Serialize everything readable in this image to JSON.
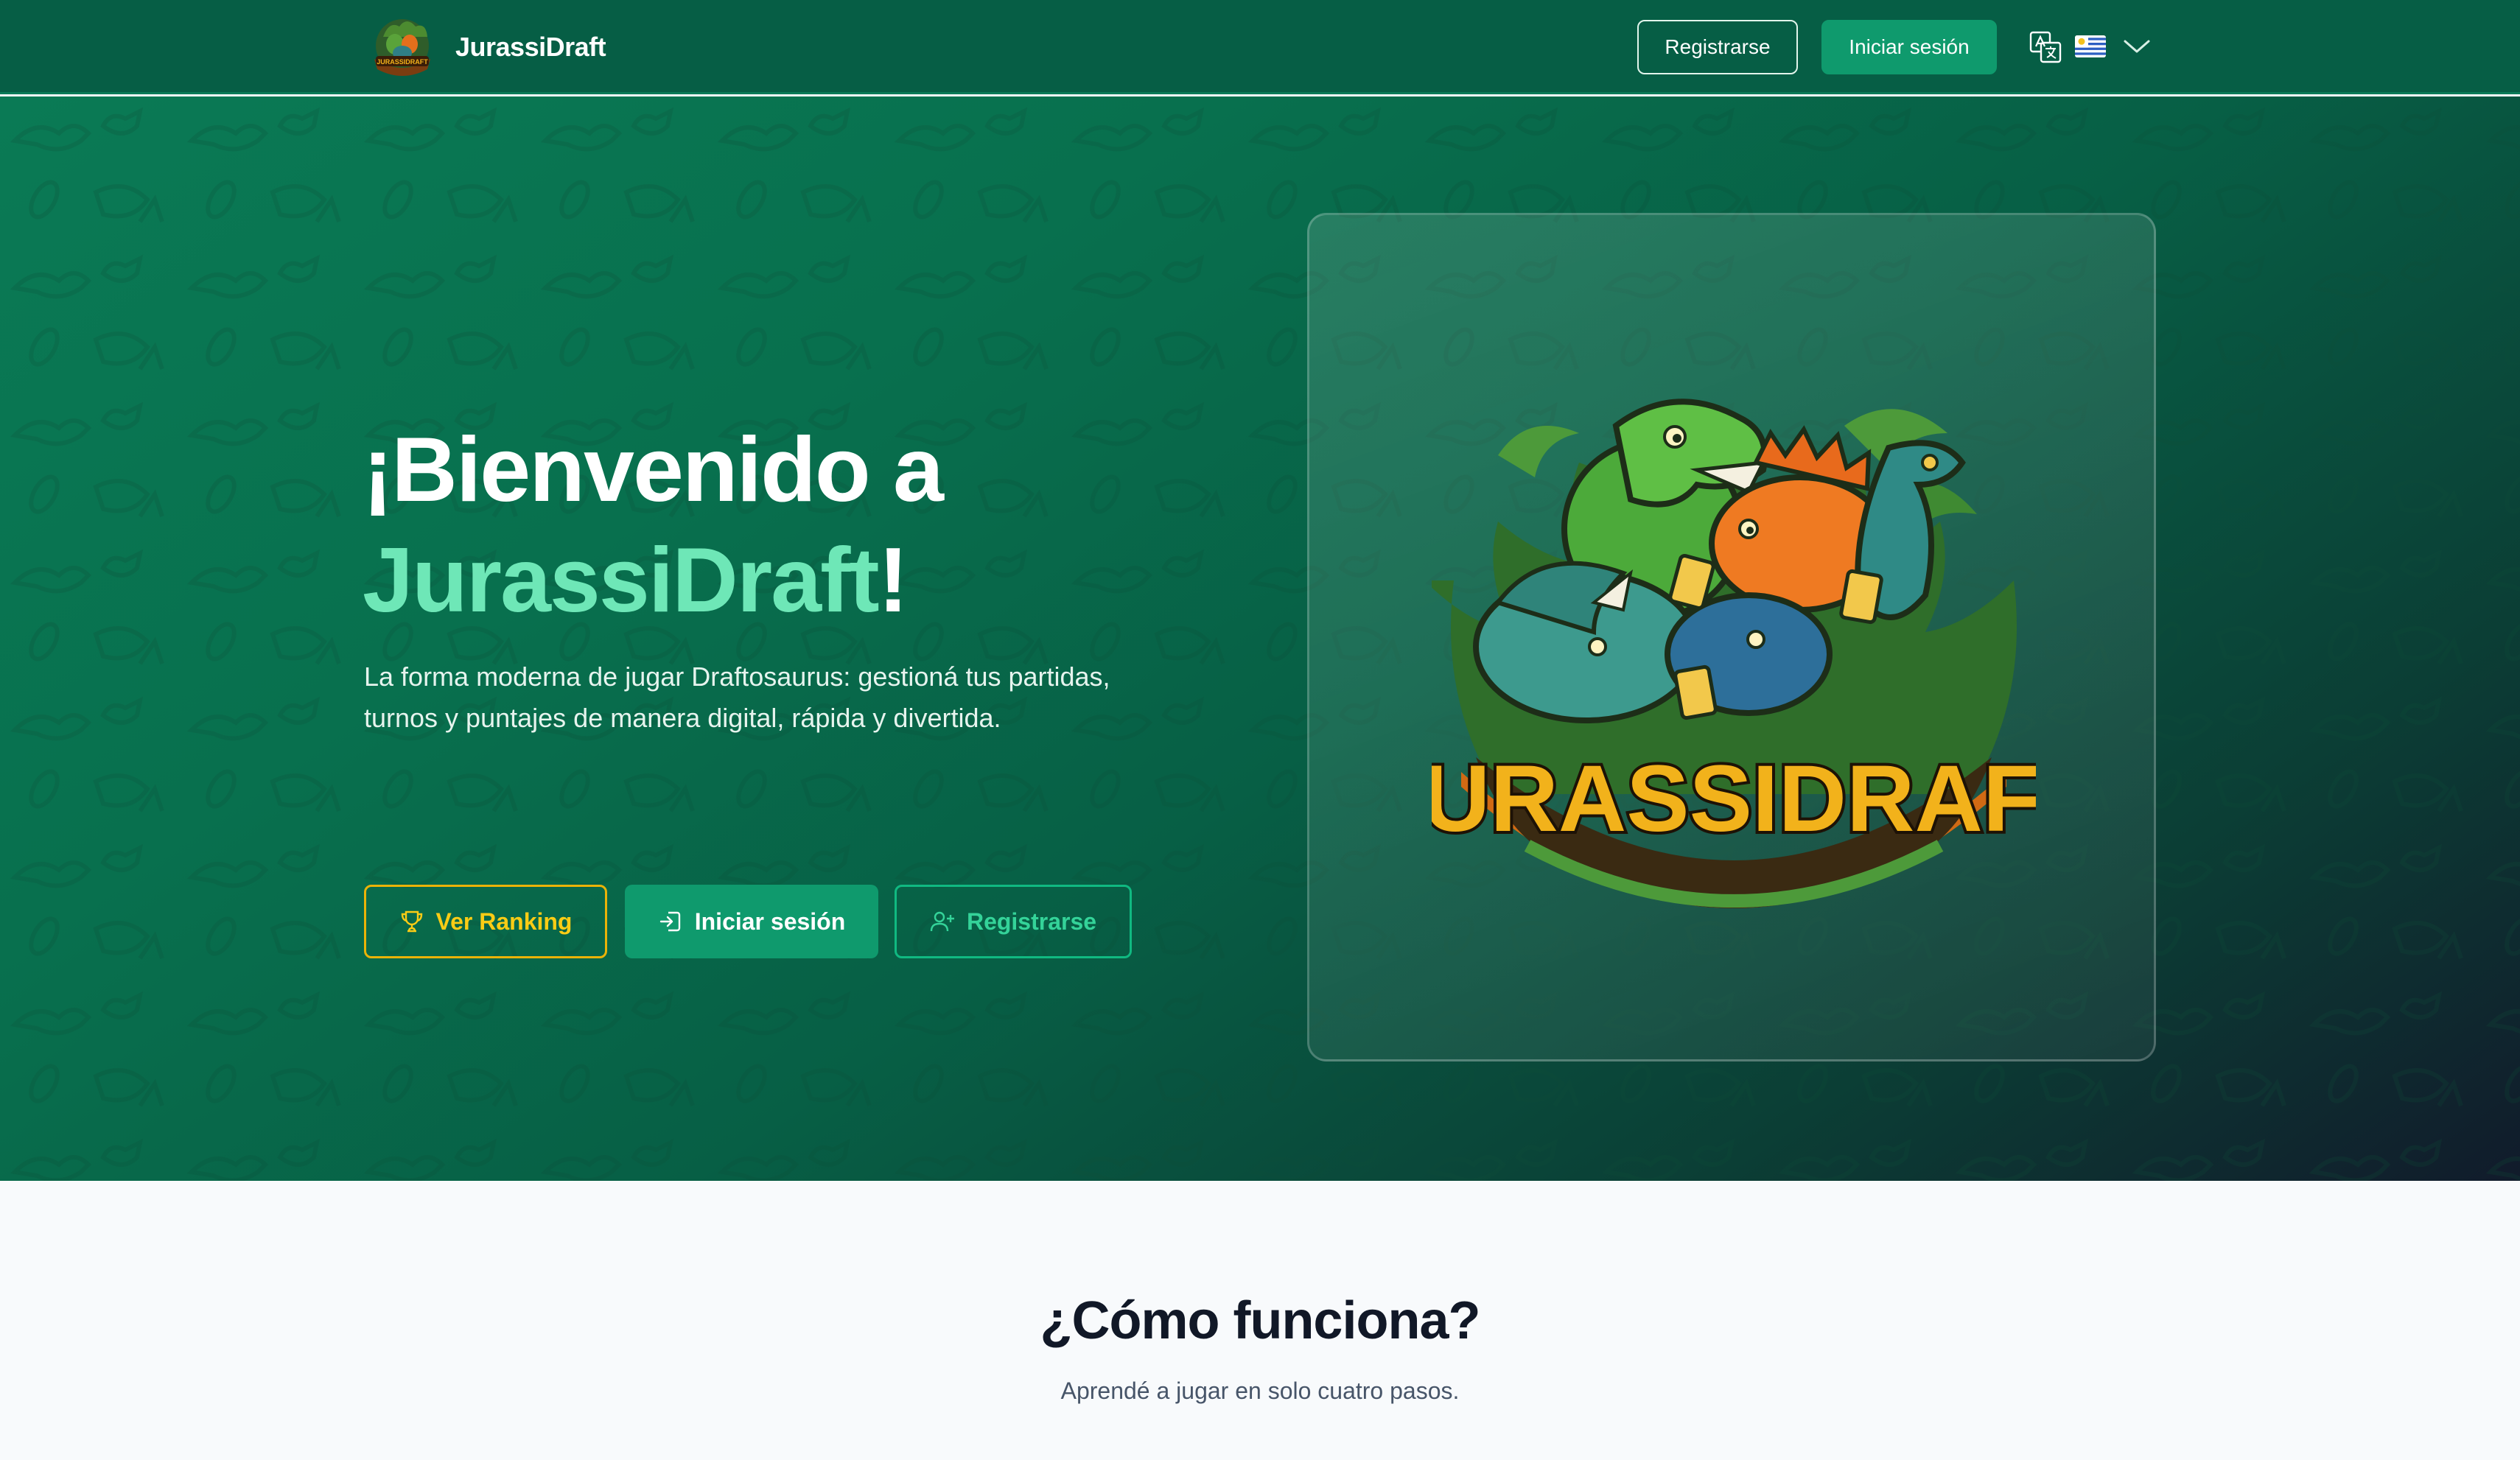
{
  "navbar": {
    "brand_name": "JurassiDraft",
    "logo_text": "JURASSIDRAFT",
    "register_label": "Registrarse",
    "login_label": "Iniciar sesión",
    "icons": [
      "language-icon",
      "uruguay-flag-icon",
      "chevron-down-icon"
    ]
  },
  "hero": {
    "title_prefix": "¡Bienvenido a",
    "title_brand": "JurassiDraft",
    "title_suffix": "!",
    "subtitle": "La forma moderna de jugar Draftosaurus: gestioná tus partidas, turnos y puntajes de manera digital, rápida y divertida.",
    "buttons": {
      "ranking": "Ver Ranking",
      "login": "Iniciar sesión",
      "register": "Registrarse"
    },
    "logo_text": "JURASSIDRAFT"
  },
  "how": {
    "title": "¿Cómo funciona?",
    "subtitle": "Aprendé a jugar en solo cuatro pasos."
  },
  "colors": {
    "navbar": "#065e45",
    "primary": "#0f9a6d",
    "accent_text": "#6ee7b7",
    "ranking": "#eab308",
    "page_bg": "#f8fafc"
  }
}
